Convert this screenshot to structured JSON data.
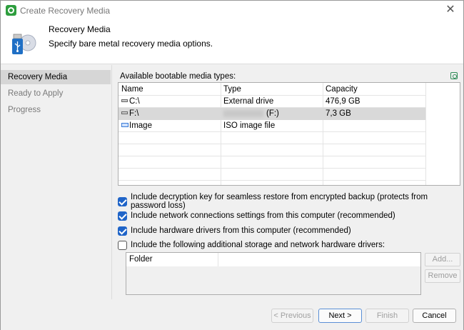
{
  "window": {
    "title": "Create Recovery Media"
  },
  "header": {
    "title": "Recovery Media",
    "subtitle": "Specify bare metal recovery media options."
  },
  "sidebar": {
    "items": [
      {
        "label": "Recovery Media"
      },
      {
        "label": "Ready to Apply"
      },
      {
        "label": "Progress"
      }
    ]
  },
  "media": {
    "label": "Available bootable media types:",
    "columns": [
      "Name",
      "Type",
      "Capacity"
    ],
    "rows": [
      {
        "name": "C:\\",
        "type": "External drive",
        "capacity": "476,9 GB"
      },
      {
        "name": "F:\\",
        "type": "(F:)",
        "capacity": "7,3 GB"
      },
      {
        "name": "Image",
        "type": "ISO image file",
        "capacity": ""
      }
    ]
  },
  "options": {
    "decryption_key": "Include decryption key for seamless restore from encrypted backup (protects from password loss)",
    "network_settings": "Include network connections settings from this computer (recommended)",
    "hardware_drivers": "Include hardware drivers from this computer (recommended)",
    "additional_drivers": "Include the following additional storage and network hardware drivers:"
  },
  "drivers": {
    "column": "Folder",
    "add_label": "Add...",
    "remove_label": "Remove"
  },
  "footer": {
    "previous": "< Previous",
    "next": "Next >",
    "finish": "Finish",
    "cancel": "Cancel"
  },
  "colors": {
    "checkbox_accent": "#1f64c8",
    "app_icon": "#2e9e3e",
    "selected_row": "#d9d9d9",
    "active_sidebar": "#d6d6d6"
  }
}
